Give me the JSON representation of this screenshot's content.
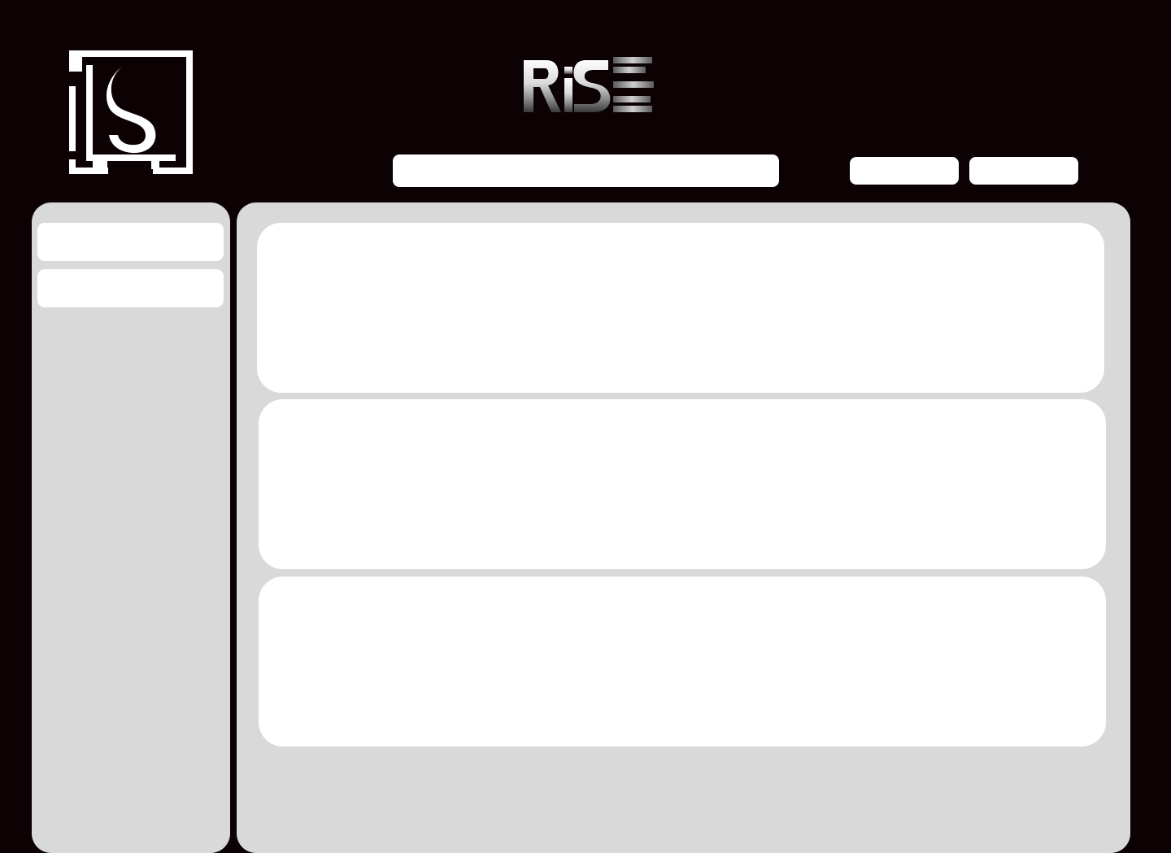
{
  "header": {
    "logo_icon": "s-hook-square-logo-icon",
    "brand_wordmark": "RiSE",
    "search": {
      "value": "",
      "placeholder": ""
    },
    "buttons": [
      {
        "label": ""
      },
      {
        "label": ""
      }
    ]
  },
  "sidebar": {
    "items": [
      {
        "label": ""
      },
      {
        "label": ""
      }
    ]
  },
  "main": {
    "cards": [
      {
        "content": ""
      },
      {
        "content": ""
      },
      {
        "content": ""
      }
    ]
  },
  "colors": {
    "background": "#0c0103",
    "panel": "#d9d9d9",
    "surface": "#ffffff"
  }
}
